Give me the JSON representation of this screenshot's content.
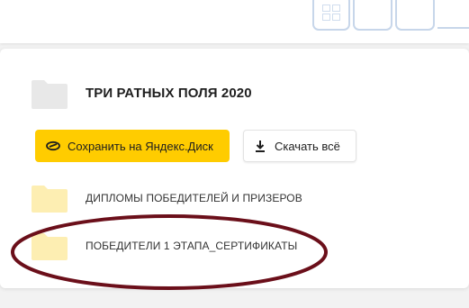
{
  "folder": {
    "title": "ТРИ РАТНЫХ ПОЛЯ 2020"
  },
  "toolbar": {
    "save_label": "Сохранить на Яндекс.Диск",
    "download_label": "Скачать всё"
  },
  "items": [
    {
      "name": "ДИПЛОМЫ ПОБЕДИТЕЛЕЙ И ПРИЗЕРОВ",
      "icon": "folder-icon"
    },
    {
      "name": "ПОБЕДИТЕЛИ 1 ЭТАПА_СЕРТИФИКАТЫ",
      "icon": "folder-icon"
    }
  ],
  "colors": {
    "accent": "#ffcc00",
    "folder": "#fdeeb2",
    "annotation": "#6b0f1a"
  }
}
